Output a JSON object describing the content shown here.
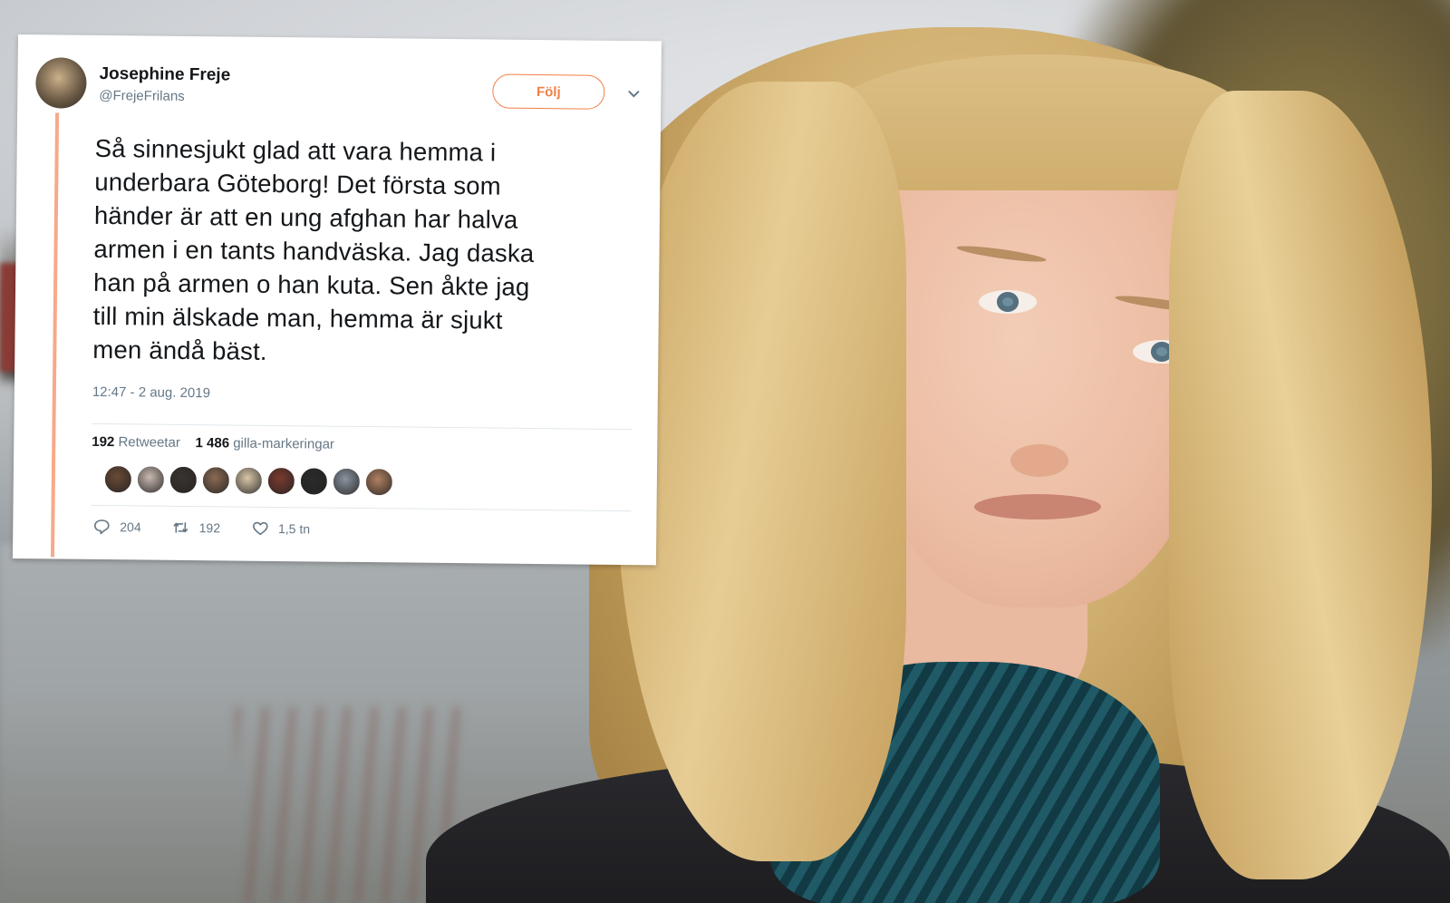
{
  "tweet": {
    "name": "Josephine Freje",
    "handle": "@FrejeFrilans",
    "follow_label": "Följ",
    "text_lines": [
      "Så sinnesjukt glad att vara hemma i",
      "underbara Göteborg! Det första som",
      "händer är att en ung afghan har halva",
      "armen i en tants handväska. Jag daska",
      "han på armen o han kuta. Sen åkte jag",
      "till min älskade man, hemma är sjukt",
      "men ändå bäst."
    ],
    "timestamp": "12:47 - 2 aug. 2019",
    "retweets_count": "192",
    "retweets_label": "Retweetar",
    "likes_count": "1 486",
    "likes_label": "gilla-markeringar",
    "replies": "204",
    "retweets_short": "192",
    "likes_short": "1,5 tn",
    "liker_colors": [
      "#6b4a36",
      "#c9b8b0",
      "#3a3430",
      "#8a6a52",
      "#d8c7a8",
      "#7a3a2e",
      "#2a2a2a",
      "#8a93a0",
      "#b08060"
    ],
    "accent": "#f27f45",
    "thread_color": "#f7a989"
  }
}
